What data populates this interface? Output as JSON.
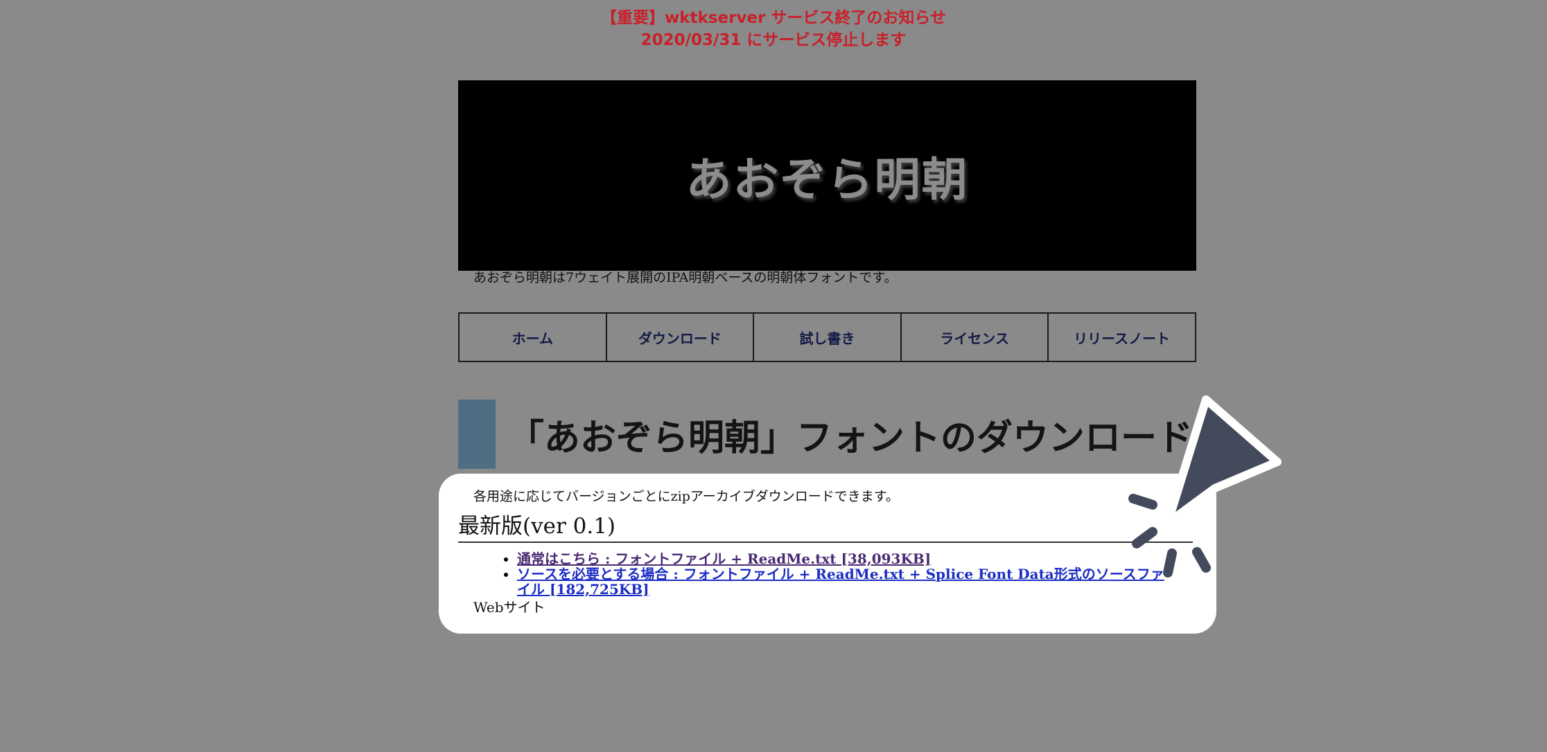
{
  "notice": {
    "line1": "【重要】wktkserver サービス終了のお知らせ",
    "line2": "2020/03/31 にサービス停止します",
    "color": "#c8202a"
  },
  "banner": {
    "title": "あおぞら明朝"
  },
  "tagline": "あおぞら明朝は7ウェイト展開のIPA明朝ベースの明朝体フォントです。",
  "nav": {
    "items": [
      {
        "label": "ホーム"
      },
      {
        "label": "ダウンロード"
      },
      {
        "label": "試し書き"
      },
      {
        "label": "ライセンス"
      },
      {
        "label": "リリースノート"
      }
    ]
  },
  "page_heading": "「あおぞら明朝」フォントのダウンロード",
  "card": {
    "description": "各用途に応じてバージョンごとにzipアーカイブダウンロードできます。",
    "version_title": "最新版(ver 0.1)",
    "downloads": [
      {
        "label": "通常はこちら : フォントファイル + ReadMe.txt [38,093KB]"
      },
      {
        "label": "ソースを必要とする場合 : フォントファイル + ReadMe.txt + Splice Font Data形式のソースファイル [182,725KB]"
      }
    ],
    "footer": "Webサイト"
  },
  "colors": {
    "background": "#8a8a8a",
    "heading_bar": "#4d6e83",
    "nav_text": "#141a46",
    "cursor": "#434a5c",
    "link_visited": "#4a2a73",
    "link": "#1c2dc4"
  },
  "overlay": {
    "icon": "cursor-click-icon"
  }
}
